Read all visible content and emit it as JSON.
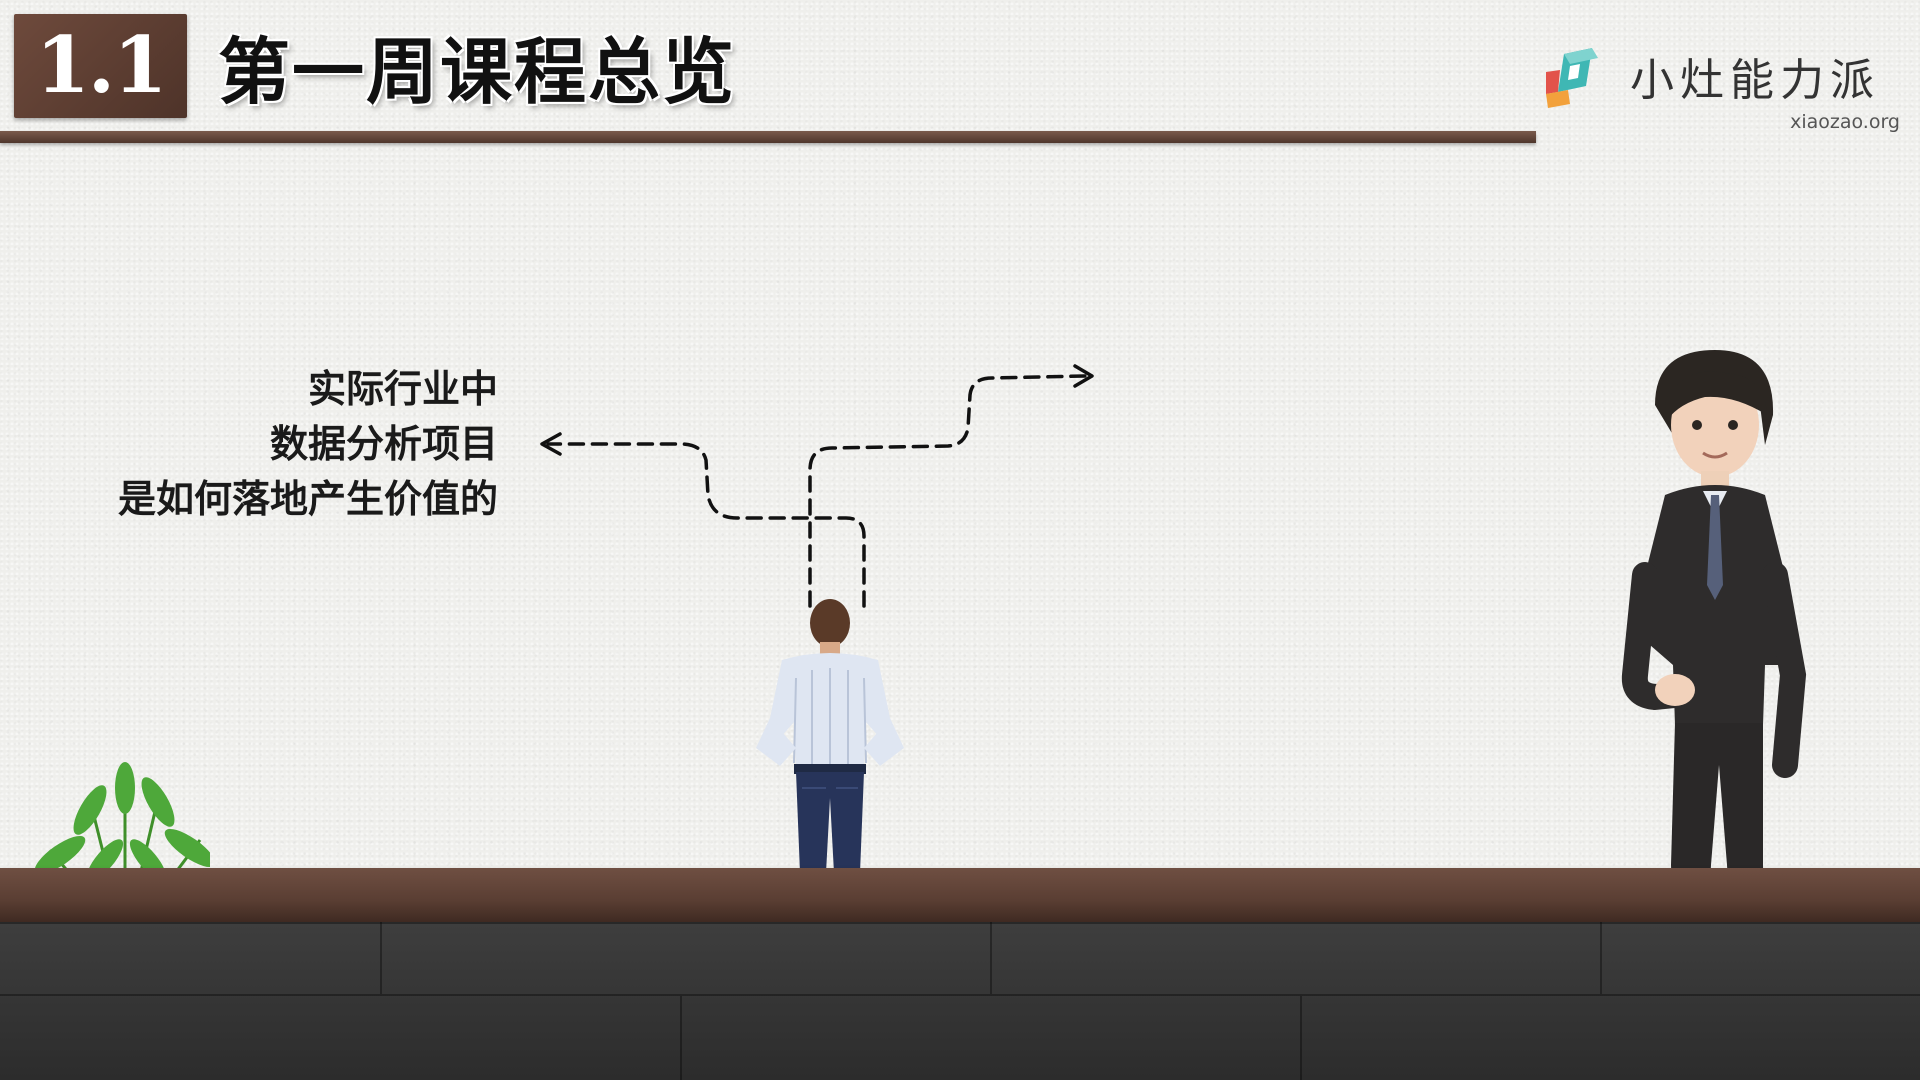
{
  "slide": {
    "section_number": "1.1",
    "title": "第一周课程总览"
  },
  "brand": {
    "name": "小灶能力派",
    "url": "xiaozao.org",
    "logo_icon": "cube-logo-icon",
    "colors": {
      "teal": "#3fb7b4",
      "red": "#e2534b",
      "orange": "#f2a13c"
    }
  },
  "topic": {
    "lines": [
      "实际行业中",
      "数据分析项目",
      "是如何落地产生价值的"
    ]
  },
  "colors": {
    "title_bar": "#5a3e33",
    "badge": "#5f4034",
    "wall": "#efefec",
    "floor": "#353535"
  }
}
